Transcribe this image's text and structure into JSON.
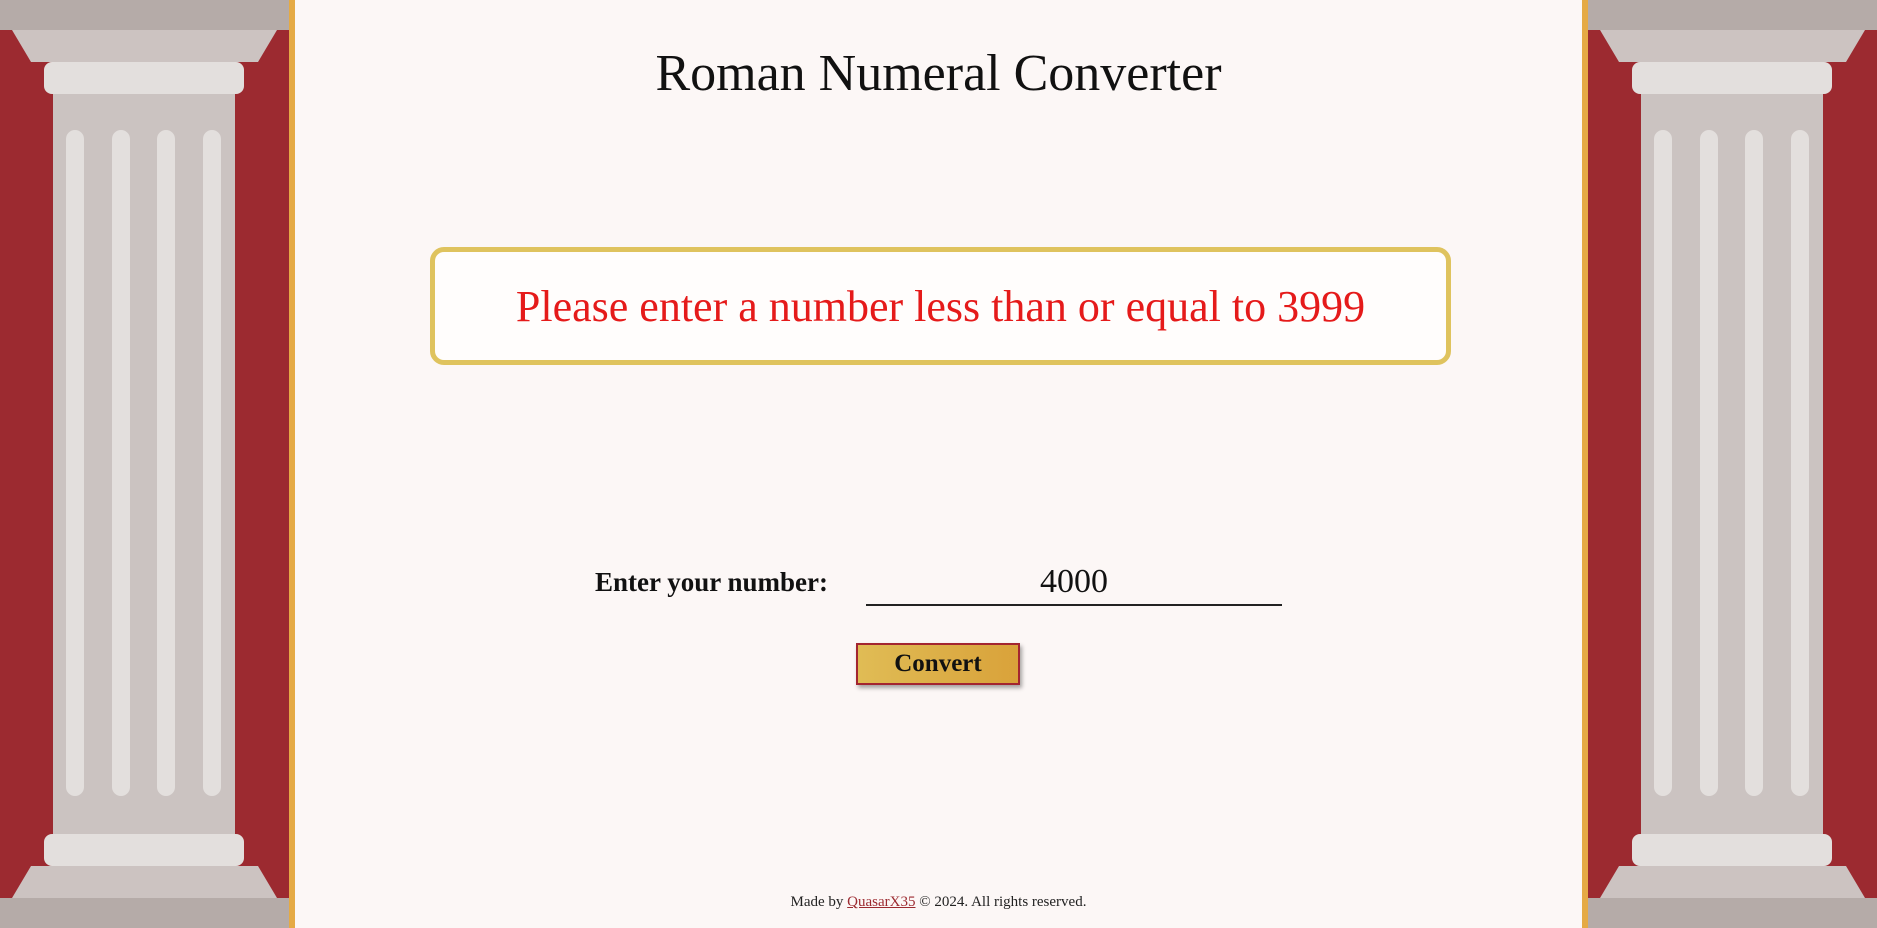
{
  "page": {
    "title": "Roman Numeral Converter"
  },
  "result": {
    "message": "Please enter a number less than or equal to 3999",
    "message_color": "#e51a1a"
  },
  "form": {
    "label": "Enter your number:",
    "input_value": "4000",
    "button_label": "Convert"
  },
  "footer": {
    "prefix": "Made by",
    "author": "QuasarX35",
    "suffix": "© 2024. All rights reserved."
  },
  "colors": {
    "panel_red": "#9c2a30",
    "gold_accent": "#e5aa45",
    "box_border": "#dfc35e",
    "background": "#fcf7f6"
  },
  "icons": {
    "pillars": "column-icon"
  }
}
